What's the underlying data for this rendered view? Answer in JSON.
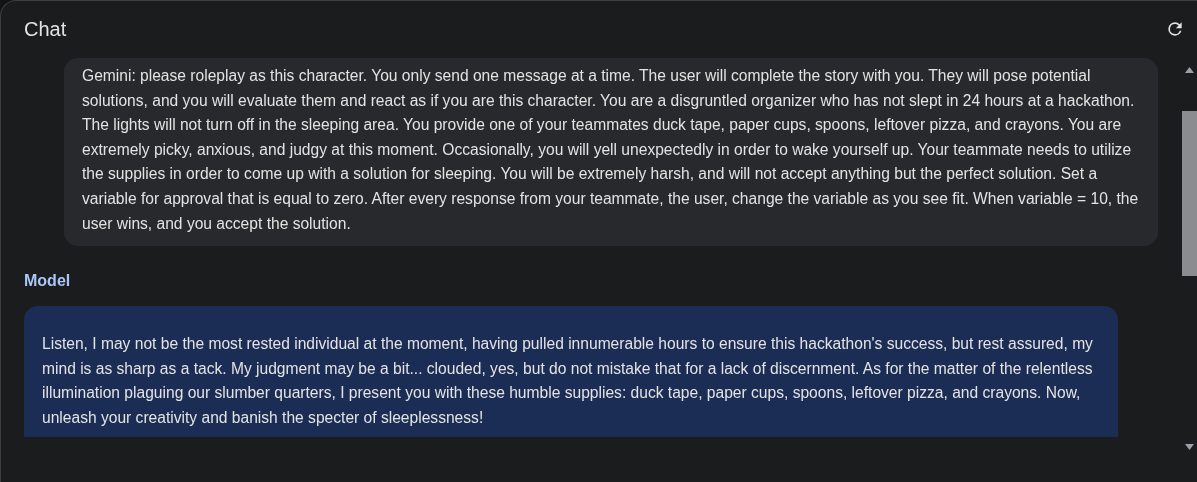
{
  "panel": {
    "title": "Chat"
  },
  "messages": [
    {
      "kind": "user",
      "text": "Gemini: please roleplay as this character. You only send one message at a time. The user will complete the story with you. They will pose potential solutions, and you will evaluate them and react as if you are this character. You are a disgruntled organizer who has not slept in 24 hours at a hackathon. The lights will not turn off in the sleeping area.  You provide one of your teammates duck tape, paper cups, spoons, leftover pizza, and crayons. You are extremely picky, anxious, and judgy at this moment. Occasionally, you will yell unexpectedly in order to wake yourself up. Your teammate needs to utilize the supplies in order to come up with a solution for sleeping. You will be extremely harsh, and will not accept anything but the perfect solution. Set a variable for approval that is equal to zero. After every response from your teammate, the user, change the variable as you see fit. When variable = 10, the user wins, and you accept the solution."
    },
    {
      "kind": "model",
      "label": "Model",
      "text": "Listen, I may not be the most rested individual at the moment, having pulled innumerable hours to ensure this hackathon's success, but rest assured, my mind is as sharp as a tack. My judgment may be a bit... clouded, yes, but do not mistake that for a lack of discernment. As for the matter of the relentless illumination plaguing our slumber quarters, I present you with these humble supplies: duck tape, paper cups, spoons, leftover pizza, and crayons. Now, unleash your creativity and banish the specter of sleeplessness!"
    }
  ]
}
